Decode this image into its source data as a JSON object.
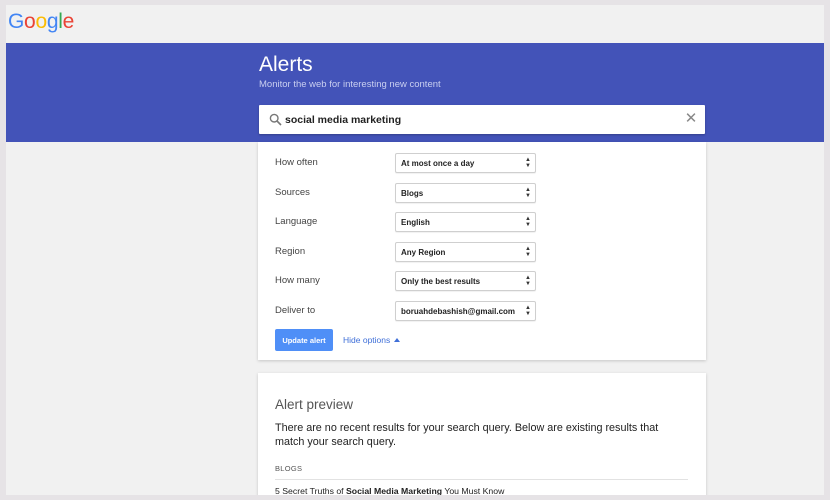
{
  "brand": {
    "logo_letters": [
      {
        "char": "G",
        "color": "#4285F4"
      },
      {
        "char": "o",
        "color": "#EA4335"
      },
      {
        "char": "o",
        "color": "#FBBC05"
      },
      {
        "char": "g",
        "color": "#4285F4"
      },
      {
        "char": "l",
        "color": "#34A853"
      },
      {
        "char": "e",
        "color": "#EA4335"
      }
    ]
  },
  "header": {
    "title": "Alerts",
    "subtitle": "Monitor the web for interesting new content",
    "accent_color": "#4353b8"
  },
  "search": {
    "value": "social media marketing",
    "clear_icon": "close-icon"
  },
  "options": {
    "rows": [
      {
        "label": "How often",
        "value": "At most once a day"
      },
      {
        "label": "Sources",
        "value": "Blogs"
      },
      {
        "label": "Language",
        "value": "English"
      },
      {
        "label": "Region",
        "value": "Any Region"
      },
      {
        "label": "How many",
        "value": "Only the best results"
      },
      {
        "label": "Deliver to",
        "value": "boruahdebashish@gmail.com"
      }
    ],
    "update_label": "Update alert",
    "hide_label": "Hide options"
  },
  "preview": {
    "title": "Alert preview",
    "message": "There are no recent results for your search query. Below are existing results that match your search query.",
    "section_label": "BLOGS",
    "result": {
      "prefix": "5 Secret Truths of ",
      "highlight": "Social Media Marketing",
      "suffix": " You Must Know"
    }
  }
}
